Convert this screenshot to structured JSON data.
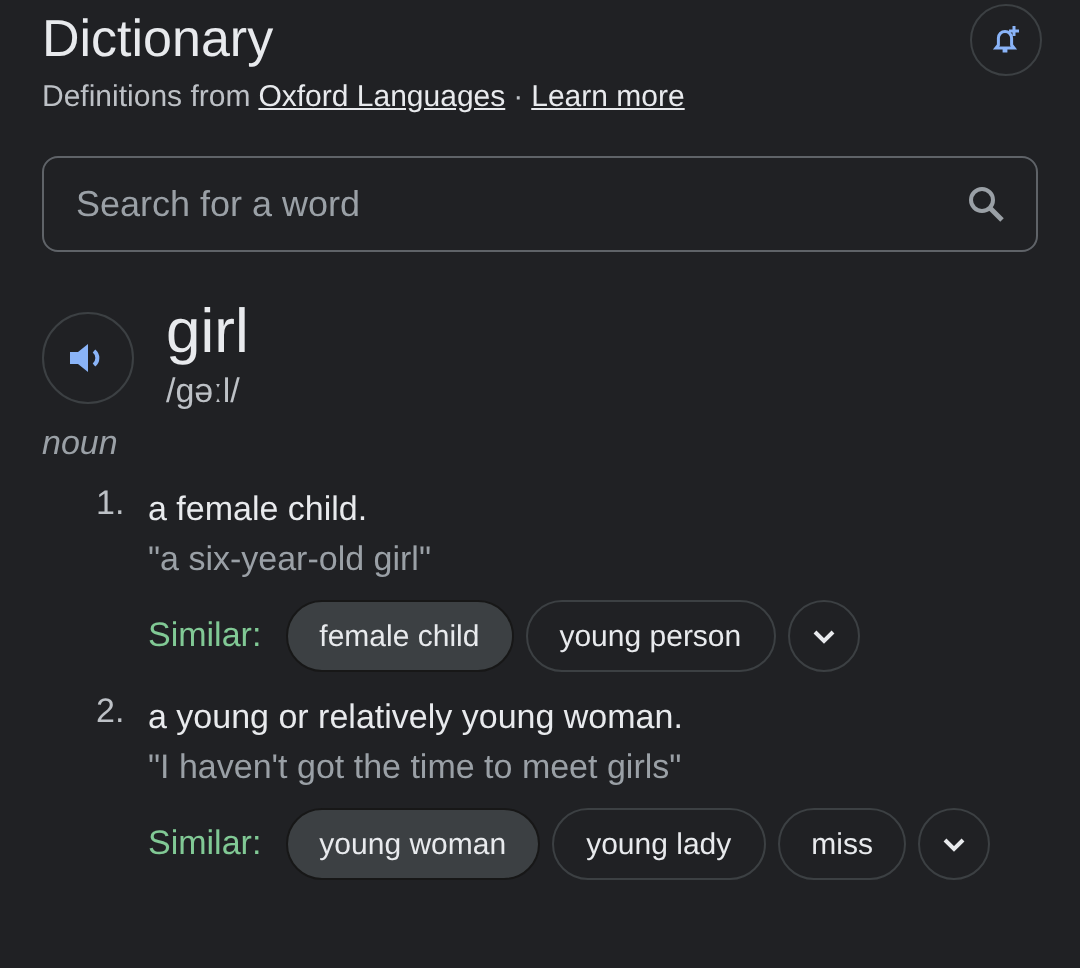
{
  "header": {
    "title": "Dictionary",
    "source_prefix": "Definitions from",
    "source_link": "Oxford Languages",
    "separator": "·",
    "learn_more": "Learn more"
  },
  "search": {
    "placeholder": "Search for a word"
  },
  "entry": {
    "word": "girl",
    "pronunciation": "/gəːl/",
    "part_of_speech": "noun"
  },
  "senses": [
    {
      "number": "1.",
      "definition": "a female child.",
      "example": "\"a six-year-old girl\"",
      "similar_label": "Similar:",
      "similar": [
        {
          "text": "female child",
          "selected": true
        },
        {
          "text": "young person",
          "selected": false
        }
      ]
    },
    {
      "number": "2.",
      "definition": "a young or relatively young woman.",
      "example": "\"I haven't got the time to meet girls\"",
      "similar_label": "Similar:",
      "similar": [
        {
          "text": "young woman",
          "selected": true
        },
        {
          "text": "young lady",
          "selected": false
        },
        {
          "text": "miss",
          "selected": false
        }
      ]
    }
  ]
}
